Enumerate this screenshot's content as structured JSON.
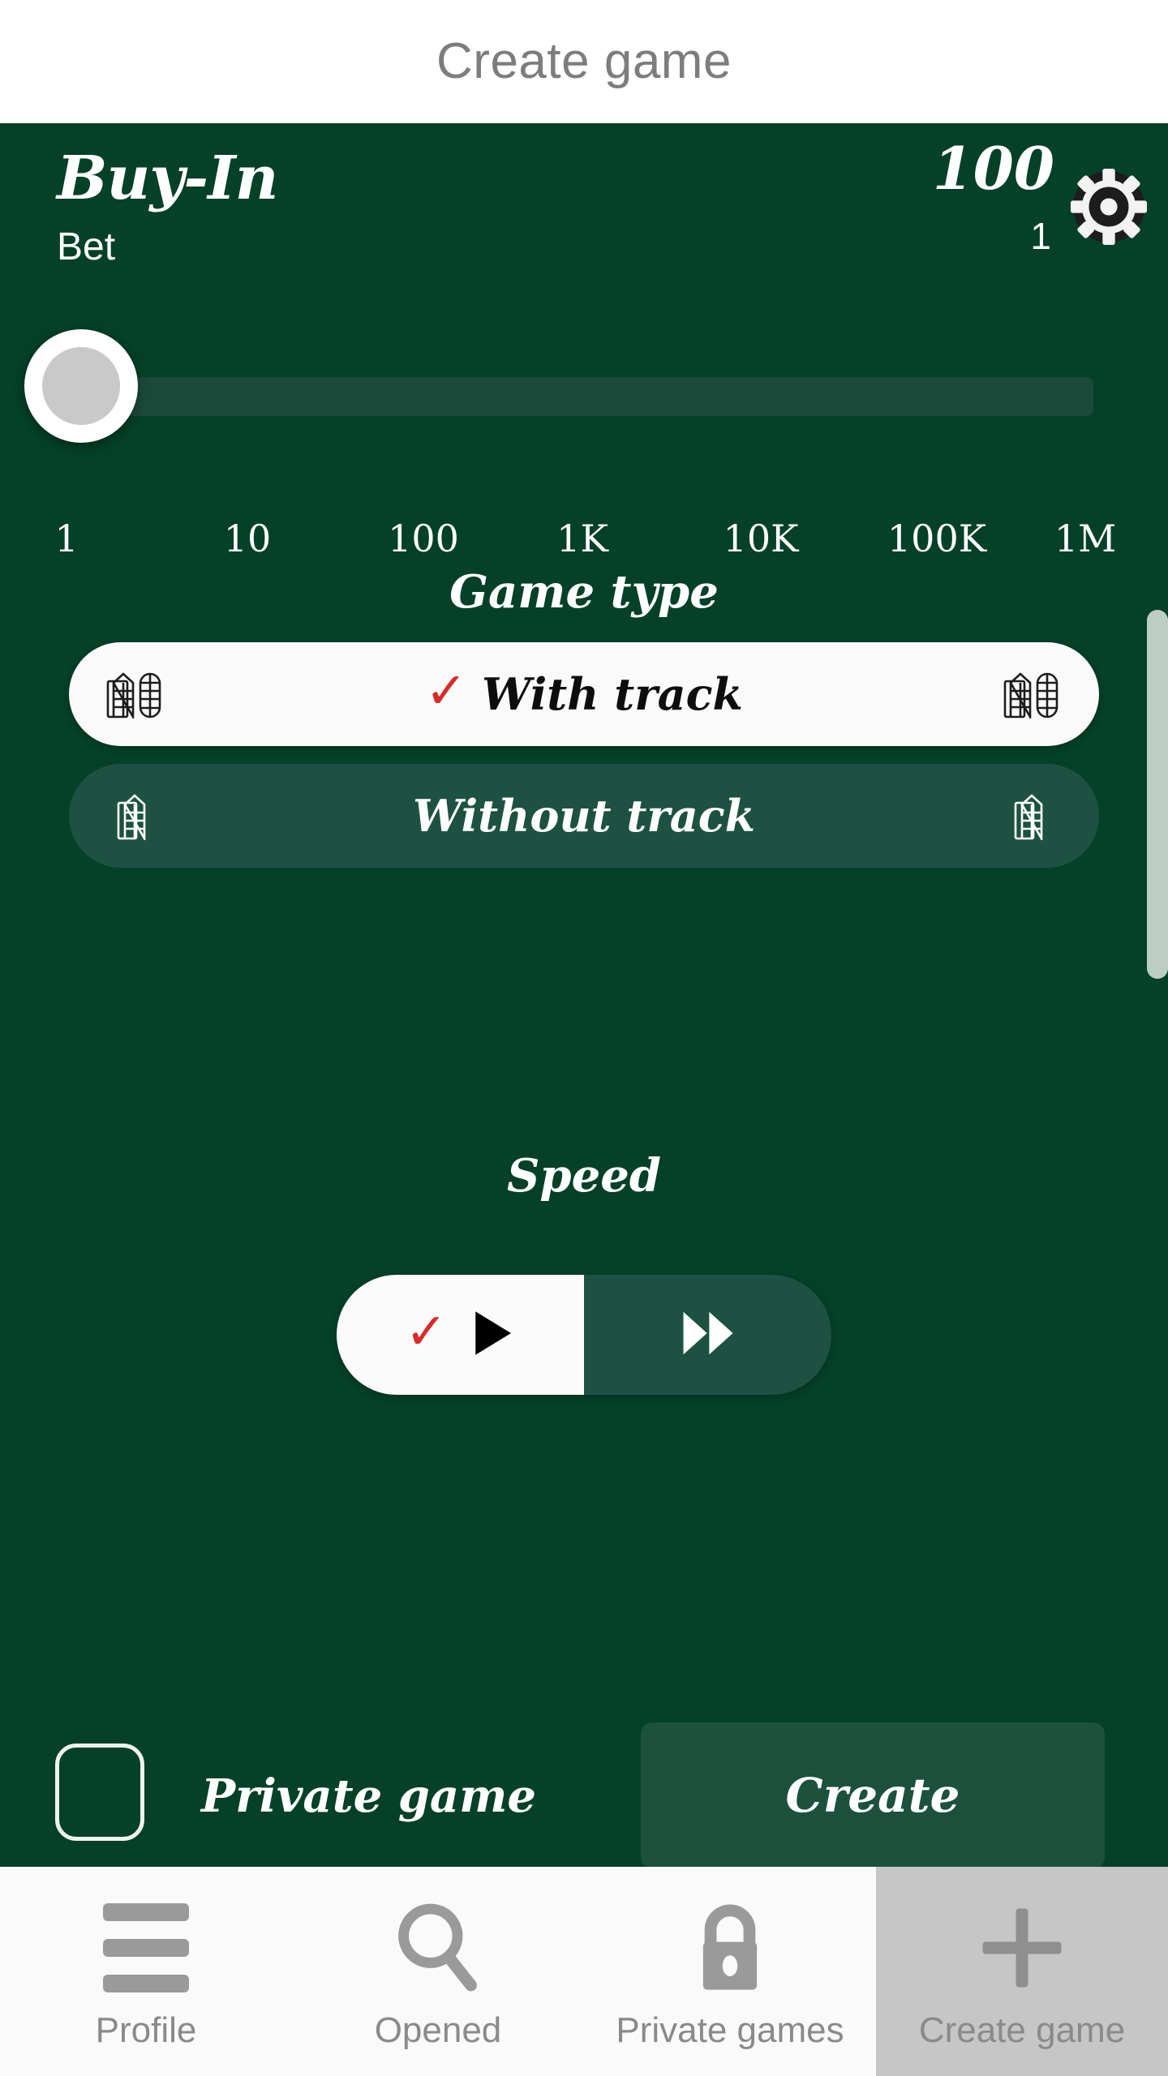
{
  "header": {
    "title": "Create game"
  },
  "buyin": {
    "title": "Buy-In",
    "bet_label": "Bet",
    "amount": "100",
    "chip_count": "1",
    "chip_icon": "poker-chip-icon"
  },
  "slider": {
    "current_value": "1",
    "ticks": [
      "1",
      "10",
      "100",
      "1K",
      "10K",
      "100K",
      "1M"
    ],
    "thumb_position_pct": 0
  },
  "game_type": {
    "title": "Game type",
    "options": [
      {
        "label": "With track",
        "selected": true,
        "check": "✓",
        "icon": "track-board-icon"
      },
      {
        "label": "Without track",
        "selected": false,
        "check": "",
        "icon": "board-icon"
      }
    ]
  },
  "speed": {
    "title": "Speed",
    "options": [
      {
        "icon": "play-icon",
        "selected": true,
        "check": "✓"
      },
      {
        "icon": "fast-forward-icon",
        "selected": false,
        "check": ""
      }
    ]
  },
  "footer": {
    "private_label": "Private game",
    "private_checked": false,
    "create_label": "Create"
  },
  "nav": {
    "items": [
      {
        "label": "Profile",
        "icon": "hamburger-icon",
        "active": false
      },
      {
        "label": "Opened",
        "icon": "search-icon",
        "active": false
      },
      {
        "label": "Private games",
        "icon": "lock-icon",
        "active": false
      },
      {
        "label": "Create game",
        "icon": "plus-icon",
        "active": true
      }
    ]
  },
  "colors": {
    "background": "#054029",
    "panel": "#1d5242",
    "accent_red": "#d82b2b",
    "nav_active": "#c6c6c6",
    "header_text": "#7d7d7d"
  }
}
